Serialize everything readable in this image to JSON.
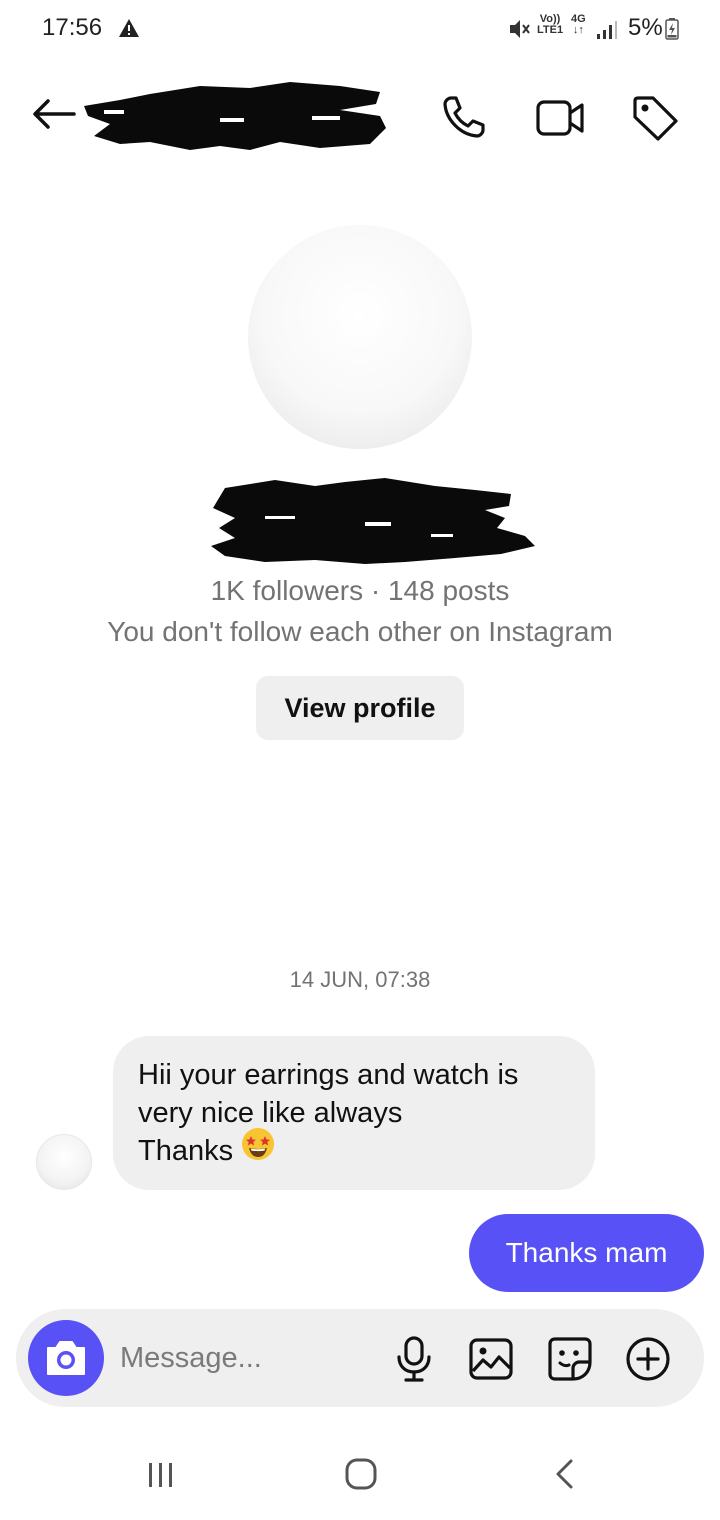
{
  "status_bar": {
    "time": "17:56",
    "volte_top": "Vo))",
    "volte_bottom": "LTE1",
    "net_top": "4G",
    "net_bottom": "↓↑",
    "battery": "5%"
  },
  "header": {
    "icons": [
      "back-arrow-icon",
      "phone-icon",
      "video-camera-icon",
      "tag-icon"
    ]
  },
  "profile": {
    "stats": "1K followers · 148 posts",
    "note": "You don't follow each other on Instagram",
    "view_profile_label": "View profile"
  },
  "conversation": {
    "timestamp": "14 JUN, 07:38",
    "messages": [
      {
        "direction": "incoming",
        "lines": [
          "Hii your earrings and watch is",
          "very nice like always",
          "Thanks"
        ],
        "emoji": "star-struck-emoji"
      },
      {
        "direction": "outgoing",
        "text": "Thanks mam"
      }
    ]
  },
  "composer": {
    "placeholder": "Message...",
    "icons": [
      "camera-icon",
      "microphone-icon",
      "gallery-icon",
      "sticker-icon",
      "plus-icon"
    ]
  },
  "colors": {
    "accent": "#5851f5",
    "bubble_incoming": "#efefef",
    "secondary_text": "#737373"
  }
}
